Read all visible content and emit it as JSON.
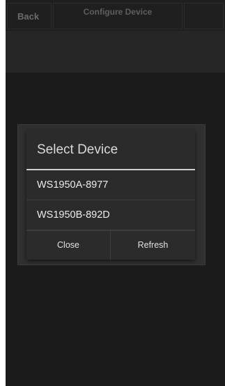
{
  "topbar": {
    "back_label": "Back",
    "title": "Configure Device"
  },
  "dialog": {
    "title": "Select Device",
    "devices": [
      {
        "label": "WS1950A-8977"
      },
      {
        "label": "WS1950B-892D"
      }
    ],
    "buttons": {
      "close_label": "Close",
      "refresh_label": "Refresh"
    }
  },
  "colors": {
    "background": "#1b1b1b",
    "dialog": "#2b2b2b",
    "divider": "#cfcfcf",
    "text": "#ececec"
  }
}
